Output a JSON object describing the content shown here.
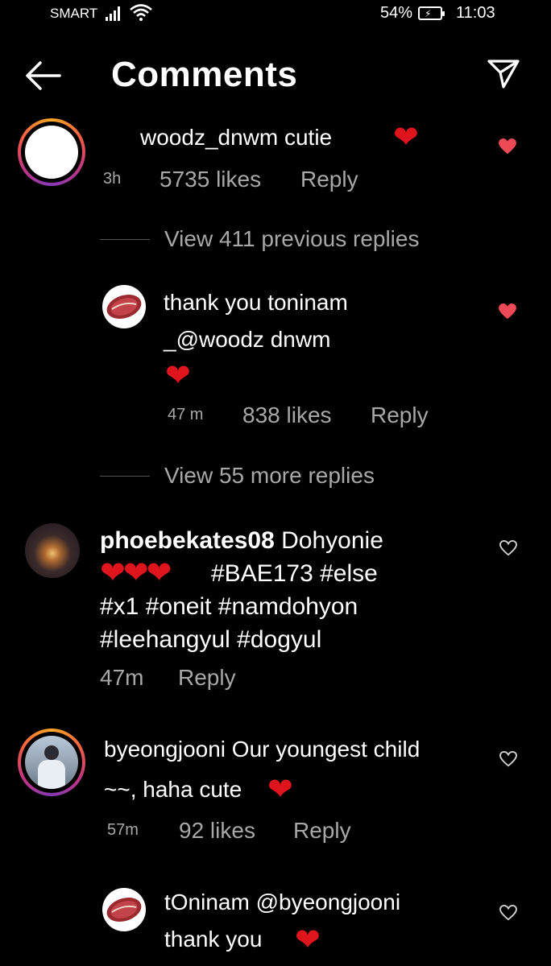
{
  "status_bar": {
    "carrier": "SMART",
    "battery": "54%",
    "time": "11:03"
  },
  "header": {
    "title": "Comments"
  },
  "comments": [
    {
      "username": "woodz_dnwm",
      "text": "cutie",
      "emoji": "❤",
      "time": "3h",
      "likes": "5735 likes",
      "reply": "Reply"
    },
    {
      "view_replies": "View 411 previous replies"
    },
    {
      "text_line1": "thank you toninam",
      "text_line2": "_@woodz dnwm",
      "emoji": "❤",
      "time": "47 m",
      "likes": "838 likes",
      "reply": "Reply"
    },
    {
      "view_replies": "View 55 more replies"
    },
    {
      "username": "phoebekates08",
      "text_line1": "Dohyonie",
      "hearts": "❤❤❤",
      "text_line2": "#BAE173 #else",
      "text_line3": "#x1 #oneit #namdohyon",
      "text_line4": "#leehangyul #dogyul",
      "time": "47m",
      "reply": "Reply"
    },
    {
      "text_line1": "byeongjooni Our youngest child",
      "text_line2": "~~, haha cute",
      "emoji": "❤",
      "time": "57m",
      "likes": "92 likes",
      "reply": "Reply"
    },
    {
      "text_line1": "tOninam @byeongjooni",
      "text_line2": "thank you",
      "emoji": "❤"
    }
  ]
}
